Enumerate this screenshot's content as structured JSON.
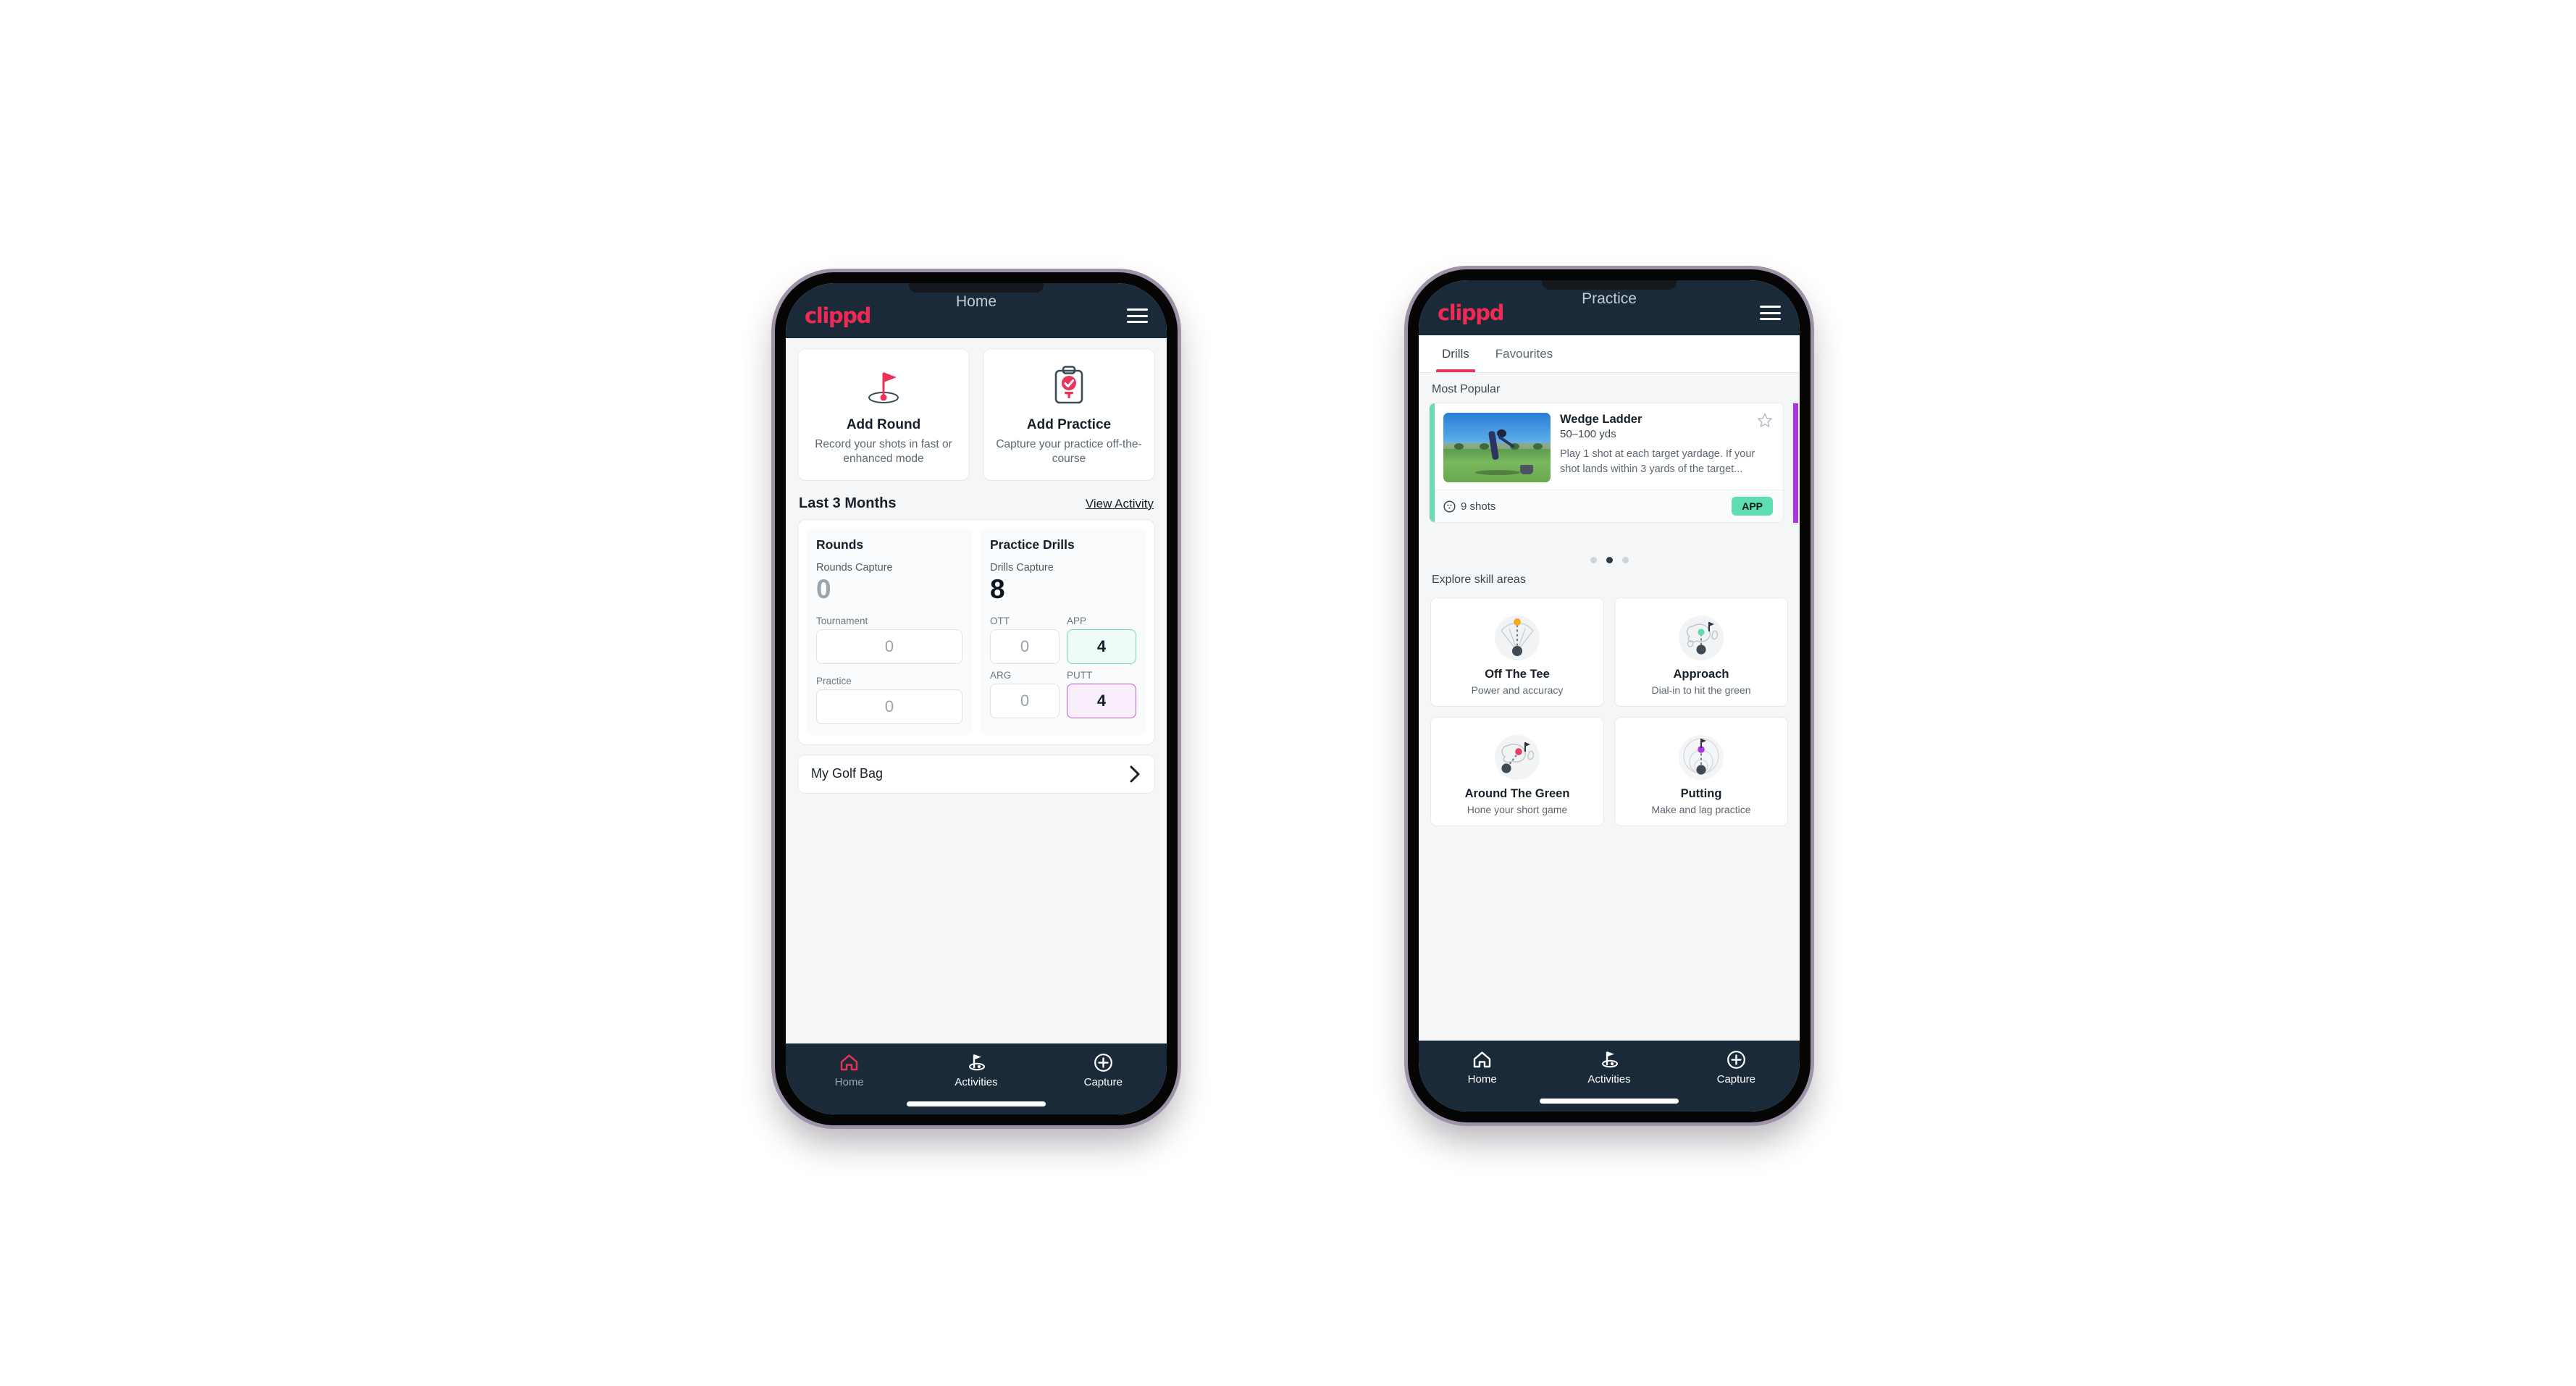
{
  "accent_colors": {
    "brand_pink": "#ef2b55",
    "header_navy": "#1b2a38",
    "mint": "#5fdcb2",
    "purple": "#a838dd",
    "orange": "#f2a91d"
  },
  "phone_home": {
    "appbar": {
      "brand": "clippd",
      "title": "Home",
      "menu_icon": "hamburger-menu-icon"
    },
    "quick_actions": [
      {
        "icon": "golf-flag-hole-icon",
        "title": "Add Round",
        "subtitle": "Record your shots in fast or enhanced mode"
      },
      {
        "icon": "clipboard-check-icon",
        "title": "Add Practice",
        "subtitle": "Capture your practice off-the-course"
      }
    ],
    "section": {
      "title": "Last 3 Months",
      "link": "View Activity"
    },
    "rounds": {
      "heading": "Rounds",
      "capture_label": "Rounds Capture",
      "capture_value": "0",
      "fields": [
        {
          "label": "Tournament",
          "value": "0"
        },
        {
          "label": "Practice",
          "value": "0"
        }
      ]
    },
    "practice_drills": {
      "heading": "Practice Drills",
      "capture_label": "Drills Capture",
      "capture_value": "8",
      "fields": [
        {
          "label": "OTT",
          "value": "0",
          "highlight": "none"
        },
        {
          "label": "APP",
          "value": "4",
          "highlight": "green"
        },
        {
          "label": "ARG",
          "value": "0",
          "highlight": "none"
        },
        {
          "label": "PUTT",
          "value": "4",
          "highlight": "purple"
        }
      ]
    },
    "golf_bag": {
      "label": "My Golf Bag",
      "chevron_icon": "chevron-right-icon"
    },
    "bottom_nav": [
      {
        "label": "Home",
        "icon": "home-icon",
        "active": true
      },
      {
        "label": "Activities",
        "icon": "golf-flag-icon",
        "active": false
      },
      {
        "label": "Capture",
        "icon": "plus-circle-icon",
        "active": false
      }
    ]
  },
  "phone_practice": {
    "appbar": {
      "brand": "clippd",
      "title": "Practice",
      "menu_icon": "hamburger-menu-icon"
    },
    "tabs": [
      {
        "label": "Drills",
        "active": true
      },
      {
        "label": "Favourites",
        "active": false
      }
    ],
    "most_popular": {
      "section_label": "Most Popular",
      "card": {
        "accent": "#6fd9b4",
        "name": "Wedge Ladder",
        "distance": "50–100 yds",
        "description": "Play 1 shot at each target yardage. If your shot lands within 3 yards of the target...",
        "shots": "9 shots",
        "shots_icon": "golf-ball-icon",
        "badge": "APP",
        "star_icon": "star-outline-icon",
        "thumbnail_alt": "golfer-hitting-wedge-photo"
      },
      "peek_accent": "#a838dd",
      "dots": [
        false,
        true,
        false
      ]
    },
    "skill_areas": {
      "section_label": "Explore skill areas",
      "cards": [
        {
          "icon": "dispersion-fan-icon",
          "name": "Off The Tee",
          "subtitle": "Power and accuracy"
        },
        {
          "icon": "green-approach-icon",
          "name": "Approach",
          "subtitle": "Dial-in to hit the green"
        },
        {
          "icon": "around-green-icon",
          "name": "Around The Green",
          "subtitle": "Hone your short game"
        },
        {
          "icon": "putting-rings-icon",
          "name": "Putting",
          "subtitle": "Make and lag practice"
        }
      ]
    },
    "bottom_nav": [
      {
        "label": "Home",
        "icon": "home-icon",
        "active": false
      },
      {
        "label": "Activities",
        "icon": "golf-flag-icon",
        "active": true
      },
      {
        "label": "Capture",
        "icon": "plus-circle-icon",
        "active": false
      }
    ]
  }
}
